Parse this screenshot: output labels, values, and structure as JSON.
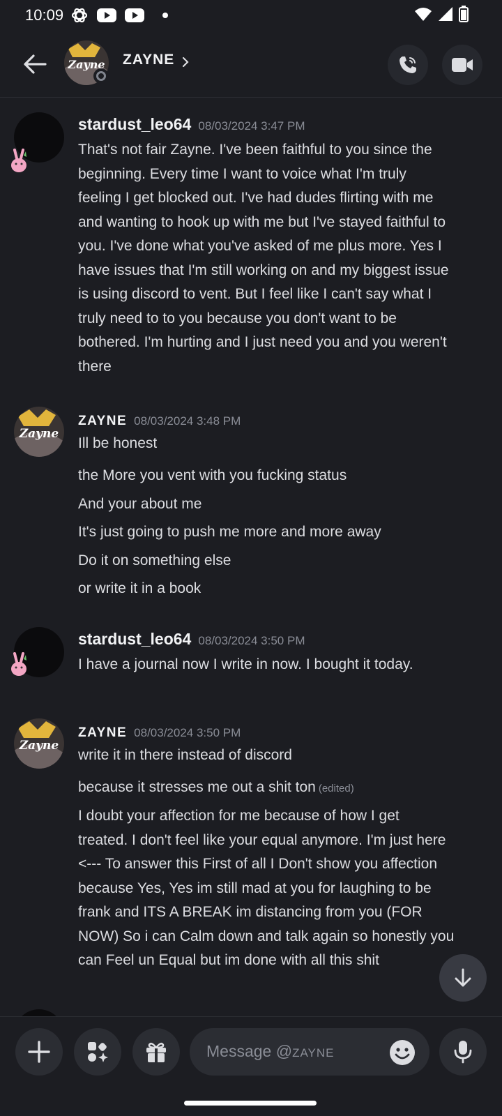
{
  "status_bar": {
    "time": "10:09"
  },
  "header": {
    "username": "ZAYNE",
    "avatar_text": "Zayne"
  },
  "messages": [
    {
      "author": "stardust_leo64",
      "timestamp": "08/03/2024 3:47 PM",
      "lines": [
        "That's not fair Zayne. I've been faithful to you since the",
        "beginning. Every time I want to voice what I'm truly",
        "feeling I get blocked out. I've had dudes flirting with me",
        "and wanting to hook up with me but I've stayed faithful to",
        "you. I've done what you've asked of me plus more. Yes I",
        "have issues that I'm still working on and my biggest issue",
        "is using discord to vent. But I feel like I can't say what I",
        "truly need to to you because you don't want to be",
        "bothered. I'm hurting and I just need you and you weren't",
        "there"
      ]
    },
    {
      "author": "ZAYNE",
      "timestamp": "08/03/2024 3:48 PM",
      "lines": [
        "Ill be honest",
        "the More you vent with you fucking status",
        "And your about me",
        "It's just going to push me more and more away",
        "Do it on something else",
        "or write it in a book"
      ]
    },
    {
      "author": "stardust_leo64",
      "timestamp": "08/03/2024 3:50 PM",
      "lines": [
        "I have a journal now I write in now. I bought it today."
      ]
    },
    {
      "author": "ZAYNE",
      "timestamp": "08/03/2024 3:50 PM",
      "lines": [
        "write it in there instead of discord",
        "because it stresses me out a shit ton",
        "I doubt your affection for me because of how I get",
        "treated. I don't feel like your equal anymore. I'm just here",
        "<--- To answer this First of all I Don't show you affection",
        "because Yes, Yes im still mad at you for laughing to be",
        "frank and ITS A BREAK im distancing from you (FOR",
        "NOW) So i can Calm down and talk again so honestly you",
        "can Feel un Equal but im done with all this shit"
      ],
      "edited_label": "(edited)"
    }
  ],
  "composer": {
    "placeholder_prefix": "Message @",
    "placeholder_user": "ZAYNE"
  }
}
